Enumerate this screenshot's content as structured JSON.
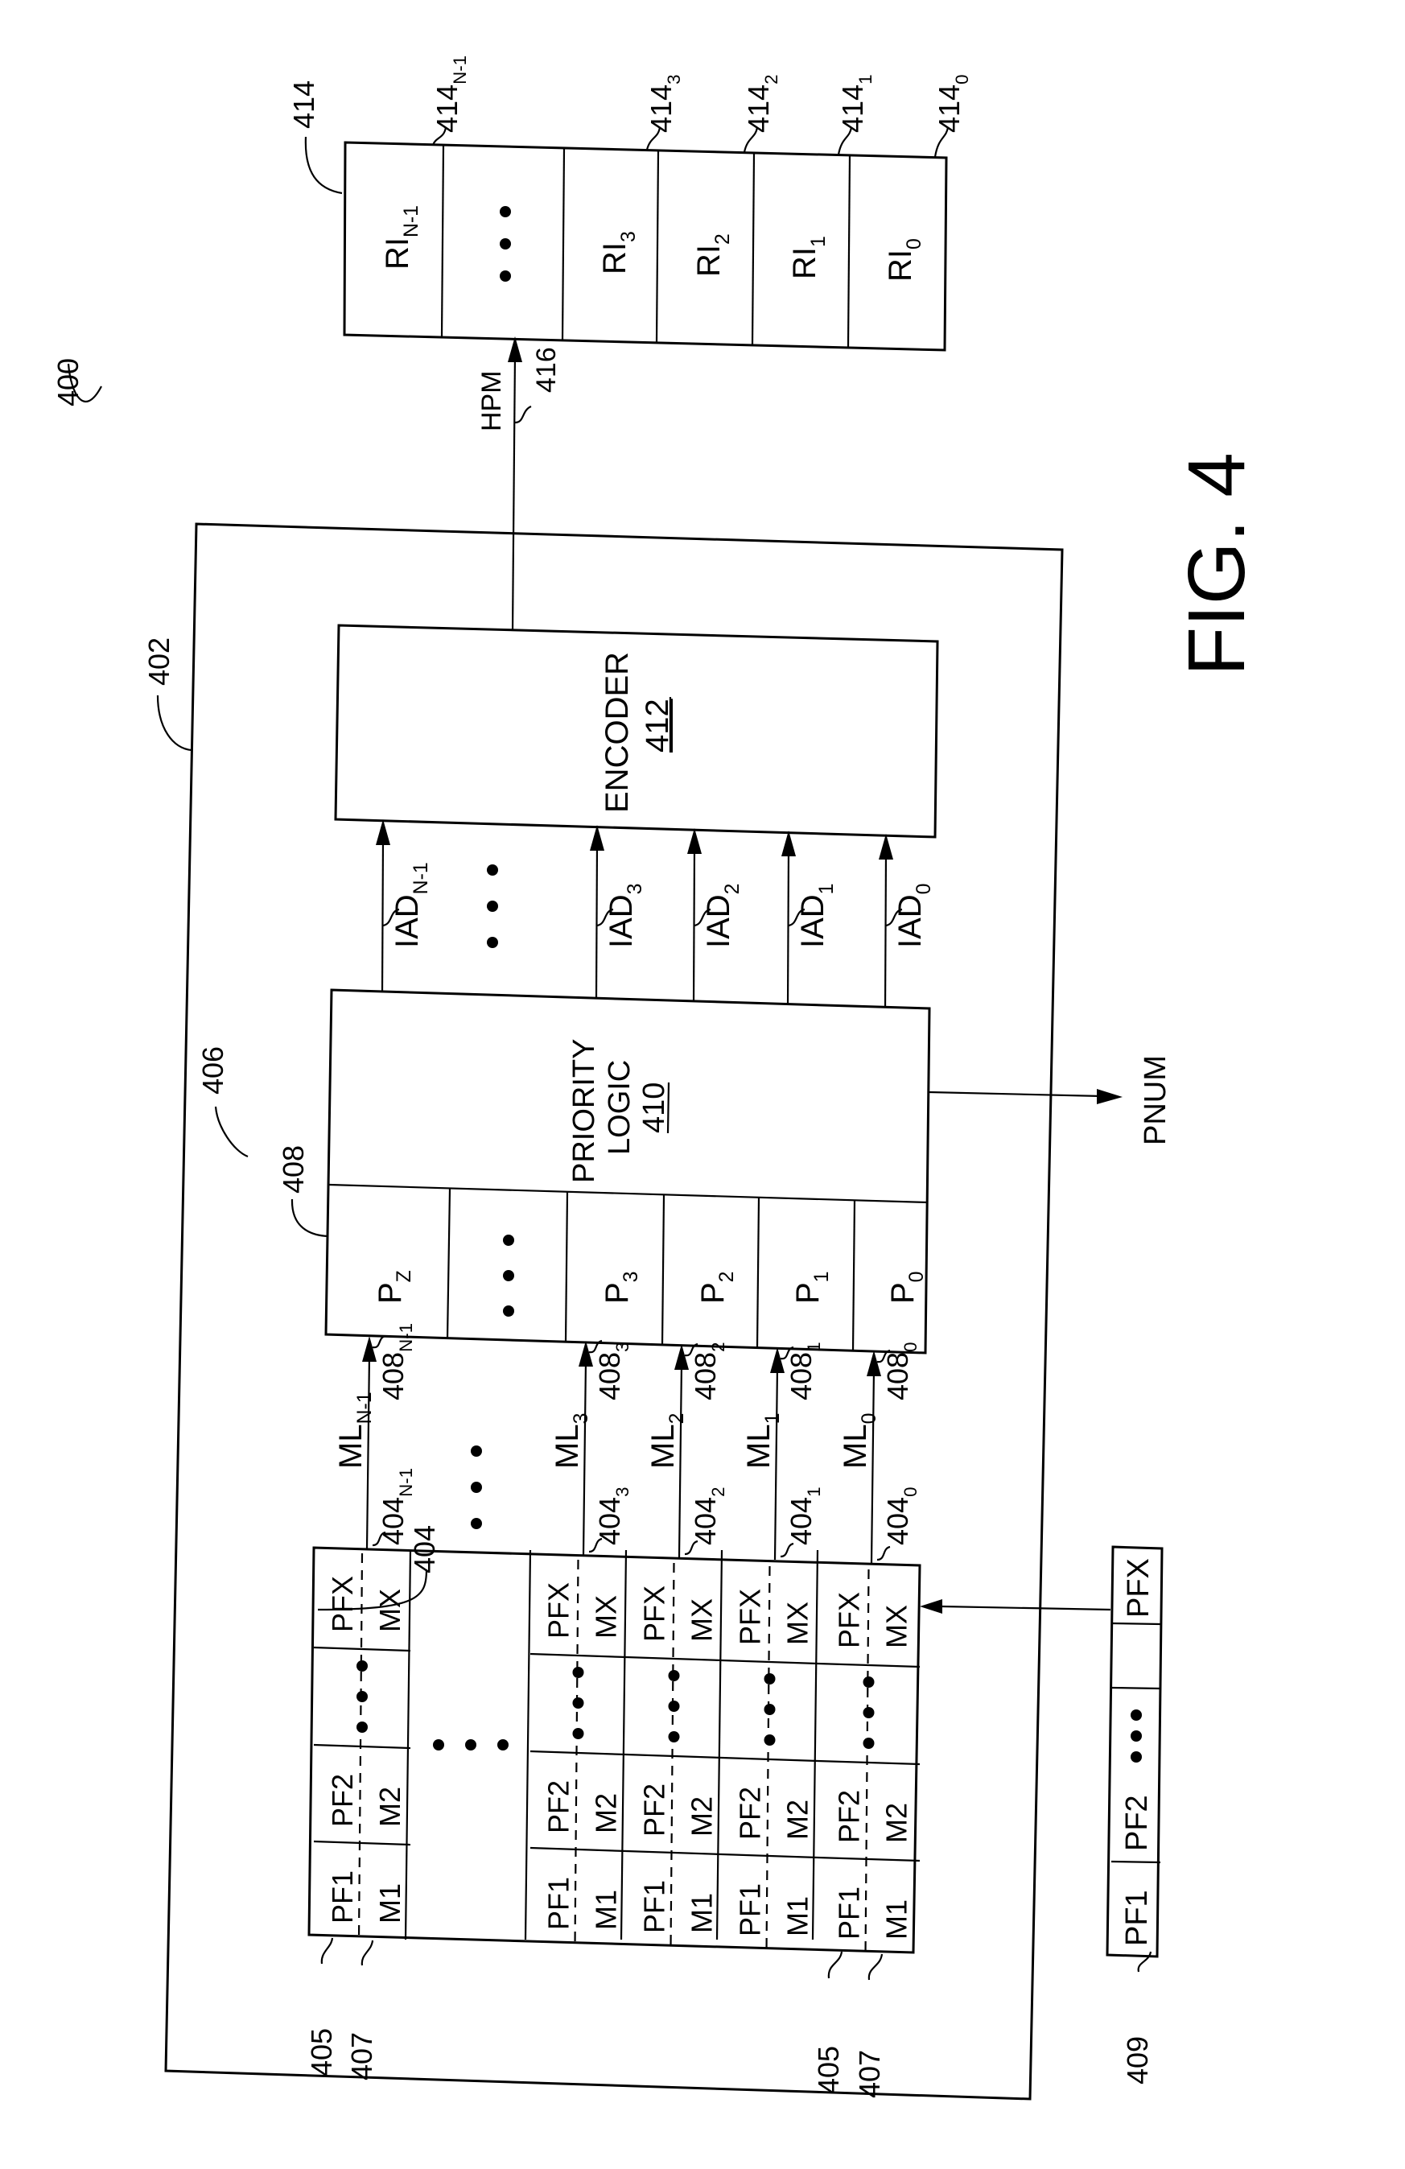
{
  "figure": {
    "title": "FIG. 4",
    "ref_system": "400",
    "ref_cam_device": "402",
    "ref_cam_array": "404",
    "ref_priority_index_table": "406",
    "ref_priority_memory": "408",
    "ref_prefix_field": "405",
    "ref_mask_field": "407",
    "ref_search_key": "409",
    "ref_route_info_table": "414",
    "ref_hpm_line": "416"
  },
  "route_info": {
    "cells": [
      {
        "label": "RI",
        "sub": "N-1",
        "ref": "414",
        "ref_sub": "N-1"
      },
      {
        "label": "• • •",
        "sub": "",
        "ref": "",
        "ref_sub": ""
      },
      {
        "label": "RI",
        "sub": "3",
        "ref": "414",
        "ref_sub": "3"
      },
      {
        "label": "RI",
        "sub": "2",
        "ref": "414",
        "ref_sub": "2"
      },
      {
        "label": "RI",
        "sub": "1",
        "ref": "414",
        "ref_sub": "1"
      },
      {
        "label": "RI",
        "sub": "0",
        "ref": "414",
        "ref_sub": "0"
      }
    ]
  },
  "hpm": {
    "label": "HPM"
  },
  "encoder": {
    "name": "ENCODER",
    "ref": "412"
  },
  "iad": [
    {
      "label": "IAD",
      "sub": "N-1"
    },
    {
      "label": "IAD",
      "sub": "3"
    },
    {
      "label": "IAD",
      "sub": "2"
    },
    {
      "label": "IAD",
      "sub": "1"
    },
    {
      "label": "IAD",
      "sub": "0"
    }
  ],
  "priority_logic": {
    "line1": "PRIORITY",
    "line2": "LOGIC",
    "ref": "410"
  },
  "pnum": {
    "label": "PNUM"
  },
  "priority_cells": [
    {
      "label": "P",
      "sub": "Z"
    },
    {
      "label": "• • •",
      "sub": ""
    },
    {
      "label": "P",
      "sub": "3"
    },
    {
      "label": "P",
      "sub": "2"
    },
    {
      "label": "P",
      "sub": "1"
    },
    {
      "label": "P",
      "sub": "0"
    }
  ],
  "match_lines": [
    {
      "ml": "ML",
      "ml_sub": "N-1",
      "row_ref": "404",
      "row_sub": "N-1",
      "p_ref": "408",
      "p_sub": "N-1"
    },
    {
      "ml": "ML",
      "ml_sub": "3",
      "row_ref": "404",
      "row_sub": "3",
      "p_ref": "408",
      "p_sub": "3"
    },
    {
      "ml": "ML",
      "ml_sub": "2",
      "row_ref": "404",
      "row_sub": "2",
      "p_ref": "408",
      "p_sub": "2"
    },
    {
      "ml": "ML",
      "ml_sub": "1",
      "row_ref": "404",
      "row_sub": "1",
      "p_ref": "408",
      "p_sub": "1"
    },
    {
      "ml": "ML",
      "ml_sub": "0",
      "row_ref": "404",
      "row_sub": "0",
      "p_ref": "408",
      "p_sub": "0"
    }
  ],
  "cam_row_fields": {
    "prefix": [
      "PF1",
      "PF2",
      "PFX"
    ],
    "mask": [
      "M1",
      "M2",
      "MX"
    ],
    "ellipsis": "• • •"
  },
  "search_key": {
    "fields": [
      "PF1",
      "PF2",
      "• • •",
      "PFX"
    ]
  }
}
